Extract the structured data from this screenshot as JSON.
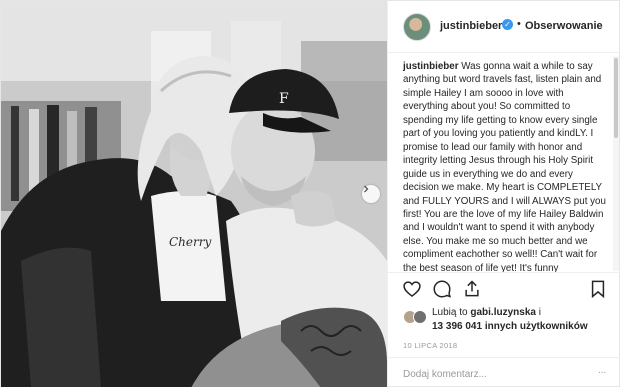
{
  "header": {
    "username": "justinbieber",
    "separator": "•",
    "follow_label": "Obserwowanie"
  },
  "caption": {
    "username": "justinbieber",
    "text": "Was gonna wait a while to say anything but word travels fast, listen plain and simple Hailey I am soooo in love with everything about you! So committed to spending my life getting to know every single part of you loving you patiently and kindLY. I promise to lead our family with honor and integrity letting Jesus through his Holy Spirit guide us in everything we do and every decision we make. My heart is COMPLETELY and FULLY YOURS and I will ALWAYS put you first! You are the love of my life Hailey Baldwin and I wouldn't want to spend it with anybody else. You make me so much better and we compliment eachother so well!! Can't wait for the best season of life yet! It's funny"
  },
  "photo": {
    "shirt_text": "Cherry"
  },
  "icons": {
    "like": "heart-icon",
    "comment": "comment-icon",
    "share": "share-icon",
    "save": "bookmark-icon",
    "verified": "verified-badge-icon",
    "carousel_next": "chevron-right-icon"
  },
  "likes": {
    "prefix": "Lubią to ",
    "first_user": "gabi.luzynska",
    "suffix": " i",
    "count": "13 396 041",
    "others": " innych użytkowników"
  },
  "date": "10 LIPCA 2018",
  "comment": {
    "placeholder": "Dodaj komentarz...",
    "dots": "..."
  },
  "colors": {
    "accent": "#3897f0",
    "text": "#262626",
    "muted": "#999999"
  }
}
